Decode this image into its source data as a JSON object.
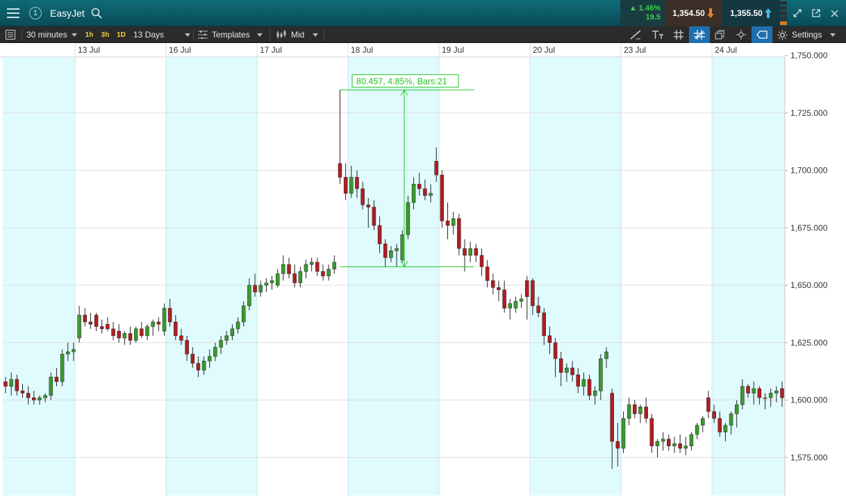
{
  "titlebar": {
    "instrument": "EasyJet",
    "change_percent": "1.46%",
    "change_points": "19.5",
    "sell_price": "1,354.50",
    "buy_price": "1,355.50",
    "info_badge": "1"
  },
  "toolbar": {
    "interval": "30 minutes",
    "periods": [
      "1h",
      "3h",
      "1D"
    ],
    "range": "13 Days",
    "templates": "Templates",
    "price_type": "Mid",
    "settings": "Settings"
  },
  "colors": {
    "up": "#3a9a2d",
    "down": "#b01e23",
    "doji": "#e0a040",
    "shade": "#e0fbfd",
    "measure": "#26c426"
  },
  "chart_data": {
    "type": "candlestick",
    "instrument": "EasyJet",
    "interval": "30 minutes",
    "x_labels": [
      "13 Jul",
      "16 Jul",
      "17 Jul",
      "18 Jul",
      "19 Jul",
      "20 Jul",
      "23 Jul",
      "24 Jul"
    ],
    "y_ticks": [
      "1,750.000",
      "1,725.000",
      "1,700.000",
      "1,675.000",
      "1,650.000",
      "1,625.000",
      "1,600.000",
      "1,575.000"
    ],
    "ylim": [
      1558,
      1753
    ],
    "measure_tool": {
      "label": "80.457, 4.85%, Bars:21",
      "from_price": 1658,
      "to_price": 1735
    },
    "candles_ohlc": [
      [
        1608,
        1610,
        1603,
        1606
      ],
      [
        1606,
        1612,
        1602,
        1609
      ],
      [
        1609,
        1611,
        1602,
        1604
      ],
      [
        1604,
        1607,
        1601,
        1603
      ],
      [
        1603,
        1606,
        1598,
        1601
      ],
      [
        1601,
        1604,
        1598,
        1600
      ],
      [
        1600,
        1602,
        1598,
        1601
      ],
      [
        1601,
        1603,
        1599,
        1602
      ],
      [
        1602,
        1612,
        1600,
        1610
      ],
      [
        1610,
        1614,
        1606,
        1608
      ],
      [
        1608,
        1622,
        1606,
        1620
      ],
      [
        1620,
        1625,
        1617,
        1621
      ],
      [
        1621,
        1625,
        1617,
        1622
      ],
      [
        1627,
        1641,
        1625,
        1637
      ],
      [
        1637,
        1640,
        1632,
        1634
      ],
      [
        1634,
        1638,
        1631,
        1633
      ],
      [
        1637,
        1638,
        1630,
        1632
      ],
      [
        1632,
        1635,
        1629,
        1631
      ],
      [
        1633,
        1636,
        1630,
        1631
      ],
      [
        1631,
        1634,
        1626,
        1628
      ],
      [
        1630,
        1633,
        1625,
        1627
      ],
      [
        1627,
        1630,
        1624,
        1629
      ],
      [
        1629,
        1632,
        1624,
        1626
      ],
      [
        1626,
        1632,
        1625,
        1631
      ],
      [
        1631,
        1634,
        1627,
        1628
      ],
      [
        1628,
        1633,
        1626,
        1632
      ],
      [
        1632,
        1635,
        1628,
        1634
      ],
      [
        1634,
        1636,
        1630,
        1633
      ],
      [
        1630,
        1642,
        1628,
        1640
      ],
      [
        1640,
        1644,
        1632,
        1634
      ],
      [
        1634,
        1637,
        1626,
        1628
      ],
      [
        1628,
        1631,
        1624,
        1626
      ],
      [
        1626,
        1628,
        1617,
        1620
      ],
      [
        1620,
        1623,
        1614,
        1616
      ],
      [
        1616,
        1619,
        1610,
        1613
      ],
      [
        1613,
        1619,
        1611,
        1617
      ],
      [
        1617,
        1622,
        1614,
        1619
      ],
      [
        1619,
        1625,
        1617,
        1623
      ],
      [
        1623,
        1628,
        1620,
        1626
      ],
      [
        1626,
        1630,
        1624,
        1628
      ],
      [
        1628,
        1633,
        1626,
        1631
      ],
      [
        1631,
        1636,
        1629,
        1634
      ],
      [
        1634,
        1643,
        1632,
        1641
      ],
      [
        1641,
        1653,
        1639,
        1650
      ],
      [
        1650,
        1655,
        1645,
        1647
      ],
      [
        1647,
        1652,
        1645,
        1650
      ],
      [
        1650,
        1653,
        1647,
        1651
      ],
      [
        1651,
        1654,
        1648,
        1652
      ],
      [
        1650,
        1657,
        1649,
        1655
      ],
      [
        1655,
        1663,
        1652,
        1659
      ],
      [
        1659,
        1662,
        1653,
        1655
      ],
      [
        1655,
        1659,
        1649,
        1651
      ],
      [
        1651,
        1658,
        1649,
        1656
      ],
      [
        1656,
        1661,
        1653,
        1659
      ],
      [
        1659,
        1662,
        1656,
        1660
      ],
      [
        1660,
        1662,
        1654,
        1656
      ],
      [
        1656,
        1659,
        1652,
        1654
      ],
      [
        1654,
        1659,
        1652,
        1657
      ],
      [
        1657,
        1663,
        1655,
        1660
      ],
      [
        1703,
        1735,
        1694,
        1697
      ],
      [
        1697,
        1703,
        1687,
        1690
      ],
      [
        1690,
        1702,
        1688,
        1697
      ],
      [
        1697,
        1700,
        1688,
        1692
      ],
      [
        1692,
        1695,
        1683,
        1685
      ],
      [
        1685,
        1688,
        1675,
        1684
      ],
      [
        1684,
        1687,
        1674,
        1676
      ],
      [
        1676,
        1680,
        1664,
        1668
      ],
      [
        1668,
        1670,
        1658,
        1662
      ],
      [
        1662,
        1667,
        1660,
        1665
      ],
      [
        1665,
        1668,
        1658,
        1666
      ],
      [
        1661,
        1674,
        1660,
        1672
      ],
      [
        1672,
        1689,
        1670,
        1686
      ],
      [
        1686,
        1697,
        1683,
        1694
      ],
      [
        1694,
        1699,
        1689,
        1692
      ],
      [
        1692,
        1696,
        1687,
        1689
      ],
      [
        1689,
        1694,
        1686,
        1690
      ],
      [
        1704,
        1710,
        1695,
        1698
      ],
      [
        1698,
        1700,
        1675,
        1678
      ],
      [
        1678,
        1686,
        1670,
        1676
      ],
      [
        1676,
        1682,
        1672,
        1679
      ],
      [
        1679,
        1681,
        1663,
        1666
      ],
      [
        1666,
        1670,
        1656,
        1663
      ],
      [
        1663,
        1669,
        1660,
        1666
      ],
      [
        1666,
        1668,
        1660,
        1663
      ],
      [
        1663,
        1666,
        1654,
        1658
      ],
      [
        1658,
        1661,
        1649,
        1652
      ],
      [
        1652,
        1655,
        1646,
        1649
      ],
      [
        1649,
        1652,
        1643,
        1648
      ],
      [
        1648,
        1652,
        1638,
        1640
      ],
      [
        1640,
        1644,
        1635,
        1642
      ],
      [
        1640,
        1645,
        1638,
        1643
      ],
      [
        1643,
        1646,
        1640,
        1644
      ],
      [
        1652,
        1654,
        1635,
        1645
      ],
      [
        1652,
        1653,
        1637,
        1641
      ],
      [
        1641,
        1645,
        1636,
        1638
      ],
      [
        1638,
        1640,
        1624,
        1628
      ],
      [
        1628,
        1632,
        1620,
        1625
      ],
      [
        1625,
        1627,
        1610,
        1618
      ],
      [
        1618,
        1621,
        1606,
        1612
      ],
      [
        1612,
        1616,
        1608,
        1614
      ],
      [
        1614,
        1617,
        1608,
        1611
      ],
      [
        1611,
        1614,
        1603,
        1606
      ],
      [
        1606,
        1612,
        1602,
        1609
      ],
      [
        1609,
        1611,
        1600,
        1602
      ],
      [
        1602,
        1606,
        1598,
        1604
      ],
      [
        1604,
        1620,
        1600,
        1618
      ],
      [
        1618,
        1623,
        1614,
        1621
      ],
      [
        1603,
        1605,
        1570,
        1582
      ],
      [
        1582,
        1590,
        1571,
        1579
      ],
      [
        1579,
        1595,
        1577,
        1592
      ],
      [
        1592,
        1601,
        1589,
        1598
      ],
      [
        1598,
        1600,
        1592,
        1594
      ],
      [
        1594,
        1598,
        1590,
        1597
      ],
      [
        1597,
        1601,
        1590,
        1592
      ],
      [
        1592,
        1594,
        1577,
        1580
      ],
      [
        1580,
        1583,
        1575,
        1582
      ],
      [
        1582,
        1586,
        1578,
        1583
      ],
      [
        1583,
        1585,
        1578,
        1580
      ],
      [
        1580,
        1584,
        1577,
        1581
      ],
      [
        1581,
        1585,
        1577,
        1579
      ],
      [
        1579,
        1584,
        1576,
        1580
      ],
      [
        1580,
        1586,
        1578,
        1585
      ],
      [
        1585,
        1590,
        1583,
        1589
      ],
      [
        1589,
        1593,
        1586,
        1592
      ],
      [
        1601,
        1604,
        1592,
        1595
      ],
      [
        1595,
        1598,
        1590,
        1592
      ],
      [
        1592,
        1595,
        1584,
        1586
      ],
      [
        1586,
        1590,
        1582,
        1589
      ],
      [
        1589,
        1595,
        1585,
        1594
      ],
      [
        1594,
        1600,
        1588,
        1598
      ],
      [
        1598,
        1609,
        1596,
        1606
      ],
      [
        1606,
        1607,
        1601,
        1603
      ],
      [
        1603,
        1608,
        1598,
        1605
      ],
      [
        1605,
        1606,
        1598,
        1601
      ],
      [
        1601,
        1603,
        1596,
        1601
      ],
      [
        1601,
        1605,
        1597,
        1603
      ],
      [
        1603,
        1606,
        1599,
        1604
      ],
      [
        1605,
        1608,
        1597,
        1601
      ]
    ]
  }
}
